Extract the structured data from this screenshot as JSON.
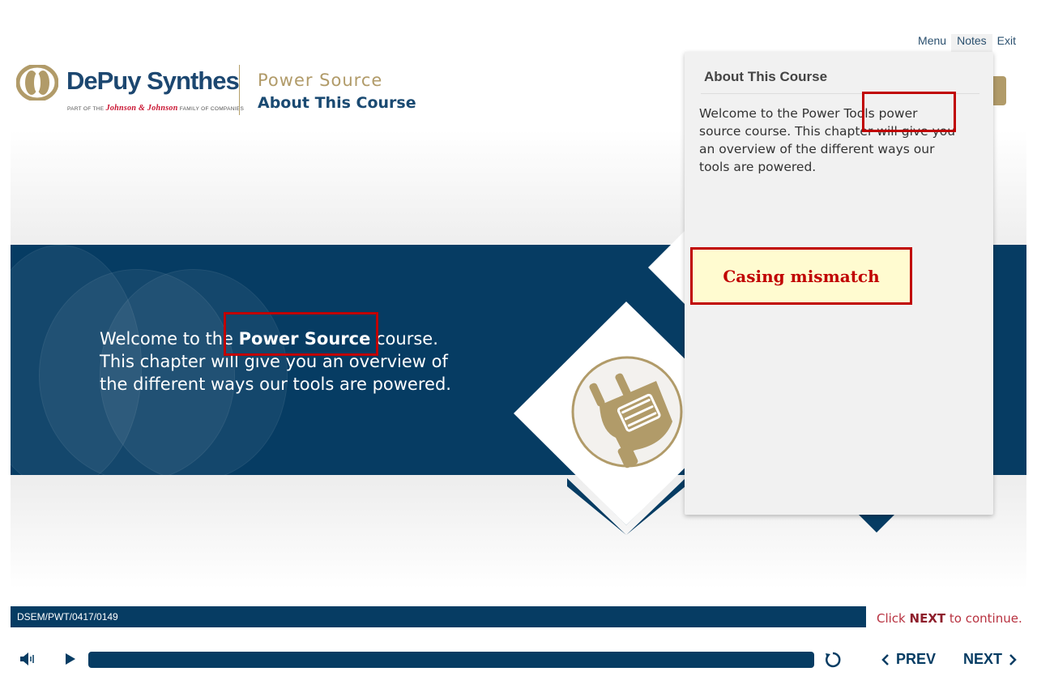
{
  "toplinks": {
    "menu": "Menu",
    "notes": "Notes",
    "exit": "Exit"
  },
  "logo": {
    "wordmark": "DePuy Synthes",
    "sub_prefix": "PART OF THE",
    "sub_brand": "Johnson & Johnson",
    "sub_suffix": "FAMILY OF COMPANIES"
  },
  "course": {
    "title": "Power Source",
    "subtitle": "About This Course"
  },
  "hero": {
    "pre": "Welcome to the ",
    "highlight": "Power Source",
    "post": " course. This chapter will give you an overview of the different ways our tools are powered."
  },
  "notes": {
    "title": "About This Course",
    "body": "Welcome to the Power Tools power source course. This chapter will give you an overview of the different ways our tools are powered."
  },
  "annotation": {
    "label": "Casing mismatch",
    "color": "#c00000"
  },
  "footer": {
    "code": "DSEM/PWT/0417/0149",
    "click_pre": "Click ",
    "click_next": "NEXT",
    "click_post": " to continue."
  },
  "controls": {
    "prev": "PREV",
    "next": "NEXT"
  },
  "colors": {
    "navy": "#063c63",
    "gold": "#b19b69",
    "alert": "#c00000"
  }
}
